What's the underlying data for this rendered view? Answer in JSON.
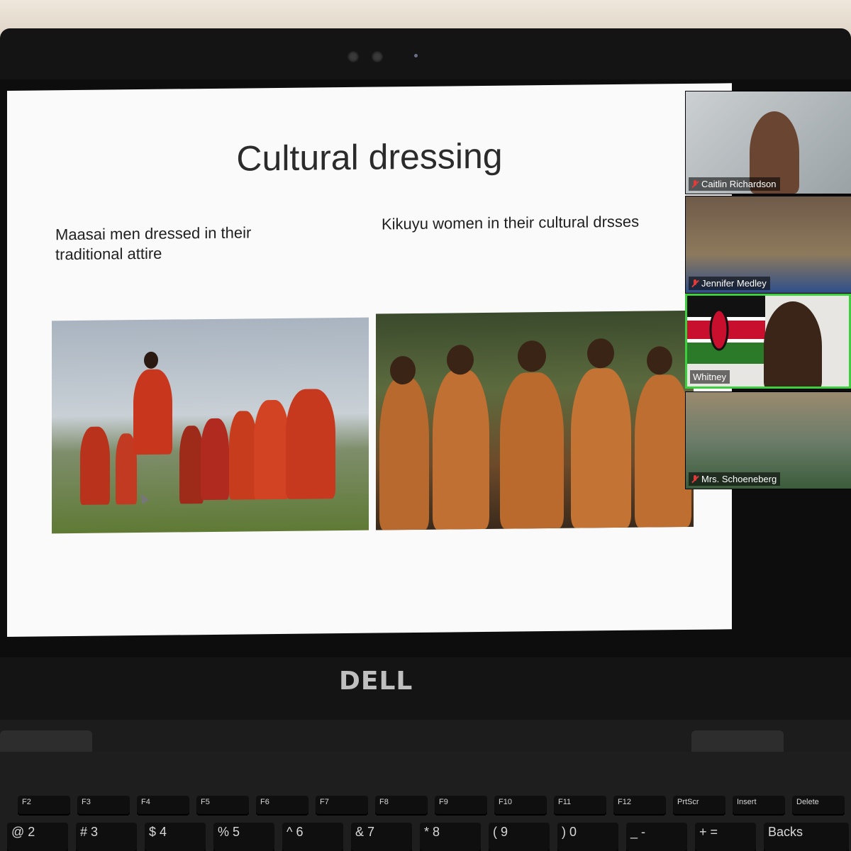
{
  "slide": {
    "title": "Cultural dressing",
    "left_caption": "Maasai men dressed in their traditional attire",
    "right_caption": "Kikuyu women in their cultural drsses"
  },
  "participants": [
    {
      "name": "Caitlin Richardson",
      "muted": true
    },
    {
      "name": "Jennifer Medley",
      "muted": true
    },
    {
      "name": "Whitney",
      "muted": false,
      "active_speaker": true
    },
    {
      "name": "Mrs. Schoeneberg",
      "muted": true
    }
  ],
  "laptop": {
    "brand_logo": "DELL"
  },
  "keyboard": {
    "function_row": [
      "F2",
      "F3",
      "F4",
      "F5",
      "F6",
      "F7",
      "F8",
      "F9",
      "F10",
      "F11",
      "F12",
      "PrtScr",
      "Insert",
      "Delete"
    ],
    "number_row": [
      "@ 2",
      "# 3",
      "$ 4",
      "% 5",
      "^ 6",
      "& 7",
      "* 8",
      "( 9",
      ") 0",
      "_ -",
      "+ =",
      "Backs"
    ]
  },
  "colors": {
    "active_speaker_border": "#3dcf3d",
    "muted_icon": "#e03c3c"
  }
}
